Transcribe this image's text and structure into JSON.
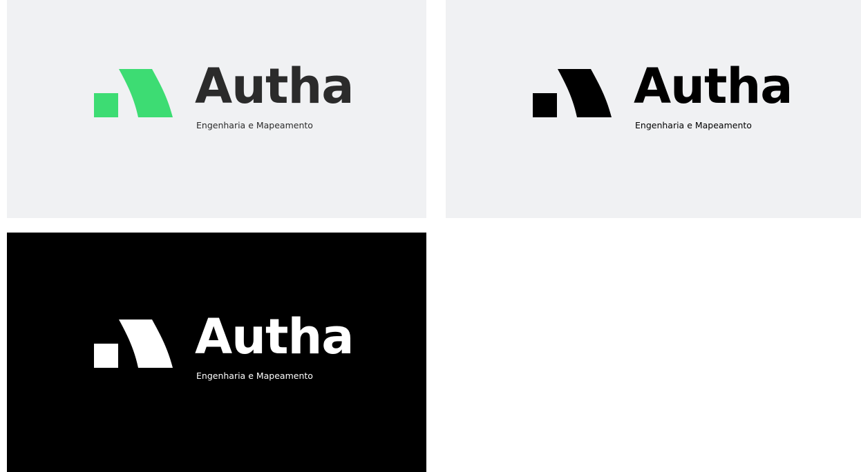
{
  "colors": {
    "light_background": "#f0f1f3",
    "dark_background": "#000000",
    "brand_green": "#3ddc73",
    "wordmark_dark": "#2b2b2b",
    "black": "#000000",
    "white": "#ffffff"
  },
  "variants": [
    {
      "label": "color-on-light",
      "background": "#f0f1f3",
      "mark_color": "#3ddc73",
      "wordmark_color": "#2b2b2b",
      "tagline_color": "#2b2b2b",
      "brand_name": "Autha",
      "tagline": "Engenharia e Mapeamento"
    },
    {
      "label": "black-on-light",
      "background": "#f0f1f3",
      "mark_color": "#000000",
      "wordmark_color": "#000000",
      "tagline_color": "#000000",
      "brand_name": "Autha",
      "tagline": "Engenharia e Mapeamento"
    },
    {
      "label": "white-on-dark",
      "background": "#000000",
      "mark_color": "#ffffff",
      "wordmark_color": "#ffffff",
      "tagline_color": "#ffffff",
      "brand_name": "Autha",
      "tagline": "Engenharia e Mapeamento"
    }
  ]
}
